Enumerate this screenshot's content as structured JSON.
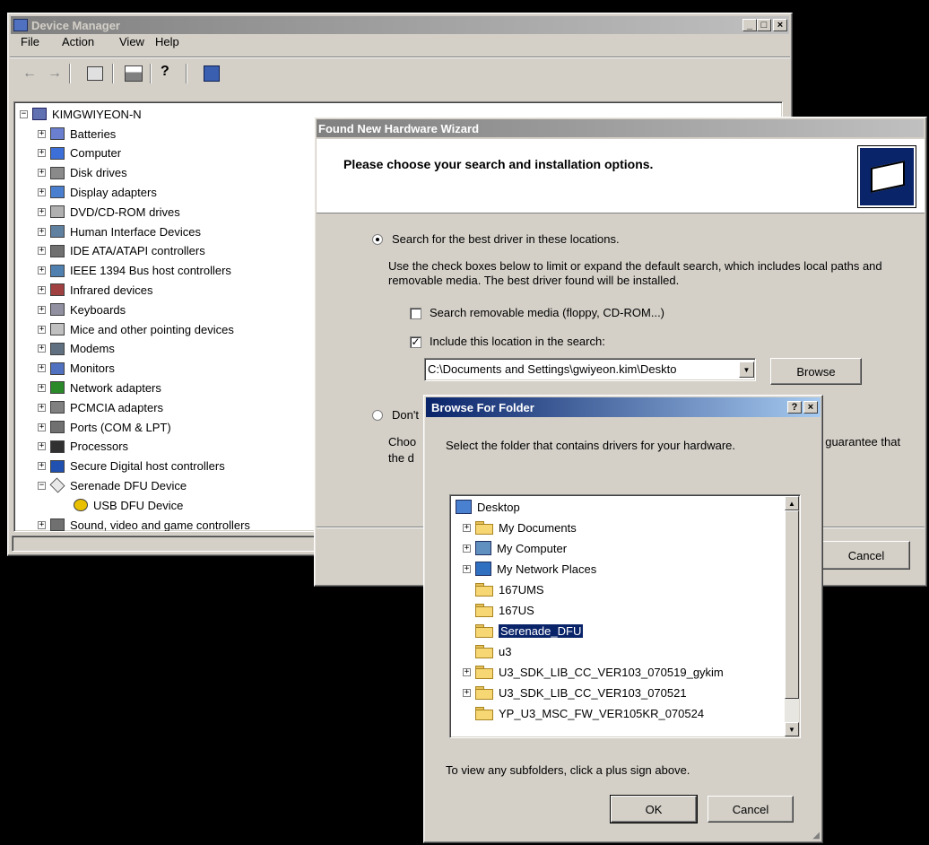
{
  "device_manager": {
    "title": "Device Manager",
    "menu": [
      "File",
      "Action",
      "View",
      "Help"
    ],
    "root": "KIMGWIYEON-N",
    "items": [
      {
        "label": "Batteries",
        "icon": "battery-icon",
        "expander": "+"
      },
      {
        "label": "Computer",
        "icon": "computer-icon",
        "expander": "+"
      },
      {
        "label": "Disk drives",
        "icon": "disk-drive-icon",
        "expander": "+"
      },
      {
        "label": "Display adapters",
        "icon": "display-adapter-icon",
        "expander": "+"
      },
      {
        "label": "DVD/CD-ROM drives",
        "icon": "cdrom-icon",
        "expander": "+"
      },
      {
        "label": "Human Interface Devices",
        "icon": "hid-icon",
        "expander": "+"
      },
      {
        "label": "IDE ATA/ATAPI controllers",
        "icon": "ide-controller-icon",
        "expander": "+"
      },
      {
        "label": "IEEE 1394 Bus host controllers",
        "icon": "ieee1394-icon",
        "expander": "+"
      },
      {
        "label": "Infrared devices",
        "icon": "infrared-icon",
        "expander": "+"
      },
      {
        "label": "Keyboards",
        "icon": "keyboard-icon",
        "expander": "+"
      },
      {
        "label": "Mice and other pointing devices",
        "icon": "mouse-icon",
        "expander": "+"
      },
      {
        "label": "Modems",
        "icon": "modem-icon",
        "expander": "+"
      },
      {
        "label": "Monitors",
        "icon": "monitor-icon",
        "expander": "+"
      },
      {
        "label": "Network adapters",
        "icon": "network-adapter-icon",
        "expander": "+"
      },
      {
        "label": "PCMCIA adapters",
        "icon": "pcmcia-icon",
        "expander": "+"
      },
      {
        "label": "Ports (COM & LPT)",
        "icon": "port-icon",
        "expander": "+"
      },
      {
        "label": "Processors",
        "icon": "processor-icon",
        "expander": "+"
      },
      {
        "label": "Secure Digital host controllers",
        "icon": "sd-controller-icon",
        "expander": "+"
      },
      {
        "label": "Serenade DFU Device",
        "icon": "serenade-device-icon",
        "expander": "-"
      },
      {
        "label": "USB DFU Device",
        "icon": "warning-device-icon",
        "expander": ""
      },
      {
        "label": "Sound, video and game controllers",
        "icon": "sound-icon",
        "expander": "+"
      }
    ]
  },
  "wizard": {
    "title": "Found New Hardware Wizard",
    "header": "Please choose your search and installation options.",
    "option1_label": "Search for the best driver in these locations.",
    "option1_desc": "Use the check boxes below to limit or expand the default search, which includes local paths and removable media. The best driver found will be installed.",
    "removable_label": "Search removable media (floppy, CD-ROM...)",
    "removable_checked": false,
    "include_label": "Include this location in the search:",
    "include_checked": true,
    "path_value": "C:\\Documents and Settings\\gwiyeon.kim\\Deskto",
    "browse_label": "Browse",
    "option2_label": "Don't",
    "option2_desc_prefix": "Choo",
    "option2_desc_suffix": "t guarantee that",
    "option2_desc_line2": "the d",
    "cancel_label": "Cancel"
  },
  "browse": {
    "title": "Browse For Folder",
    "help_btn": "?",
    "close_btn": "×",
    "instruction": "Select the folder that contains drivers for your hardware.",
    "tree": [
      {
        "label": "Desktop",
        "icon": "desktop-icon",
        "level": 0,
        "expander": ""
      },
      {
        "label": "My Documents",
        "icon": "my-documents-icon",
        "level": 1,
        "expander": "+"
      },
      {
        "label": "My Computer",
        "icon": "my-computer-icon",
        "level": 1,
        "expander": "+"
      },
      {
        "label": "My Network Places",
        "icon": "network-places-icon",
        "level": 1,
        "expander": "+"
      },
      {
        "label": "167UMS",
        "icon": "folder-icon",
        "level": 1,
        "expander": ""
      },
      {
        "label": "167US",
        "icon": "folder-icon",
        "level": 1,
        "expander": ""
      },
      {
        "label": "Serenade_DFU",
        "icon": "folder-icon",
        "level": 1,
        "expander": "",
        "selected": true
      },
      {
        "label": "u3",
        "icon": "folder-icon",
        "level": 1,
        "expander": ""
      },
      {
        "label": "U3_SDK_LIB_CC_VER103_070519_gykim",
        "icon": "folder-icon",
        "level": 1,
        "expander": "+"
      },
      {
        "label": "U3_SDK_LIB_CC_VER103_070521",
        "icon": "folder-icon",
        "level": 1,
        "expander": "+"
      },
      {
        "label": "YP_U3_MSC_FW_VER105KR_070524",
        "icon": "folder-icon",
        "level": 1,
        "expander": ""
      }
    ],
    "hint": "To view any subfolders, click a plus sign above.",
    "ok_label": "OK",
    "cancel_label": "Cancel"
  }
}
